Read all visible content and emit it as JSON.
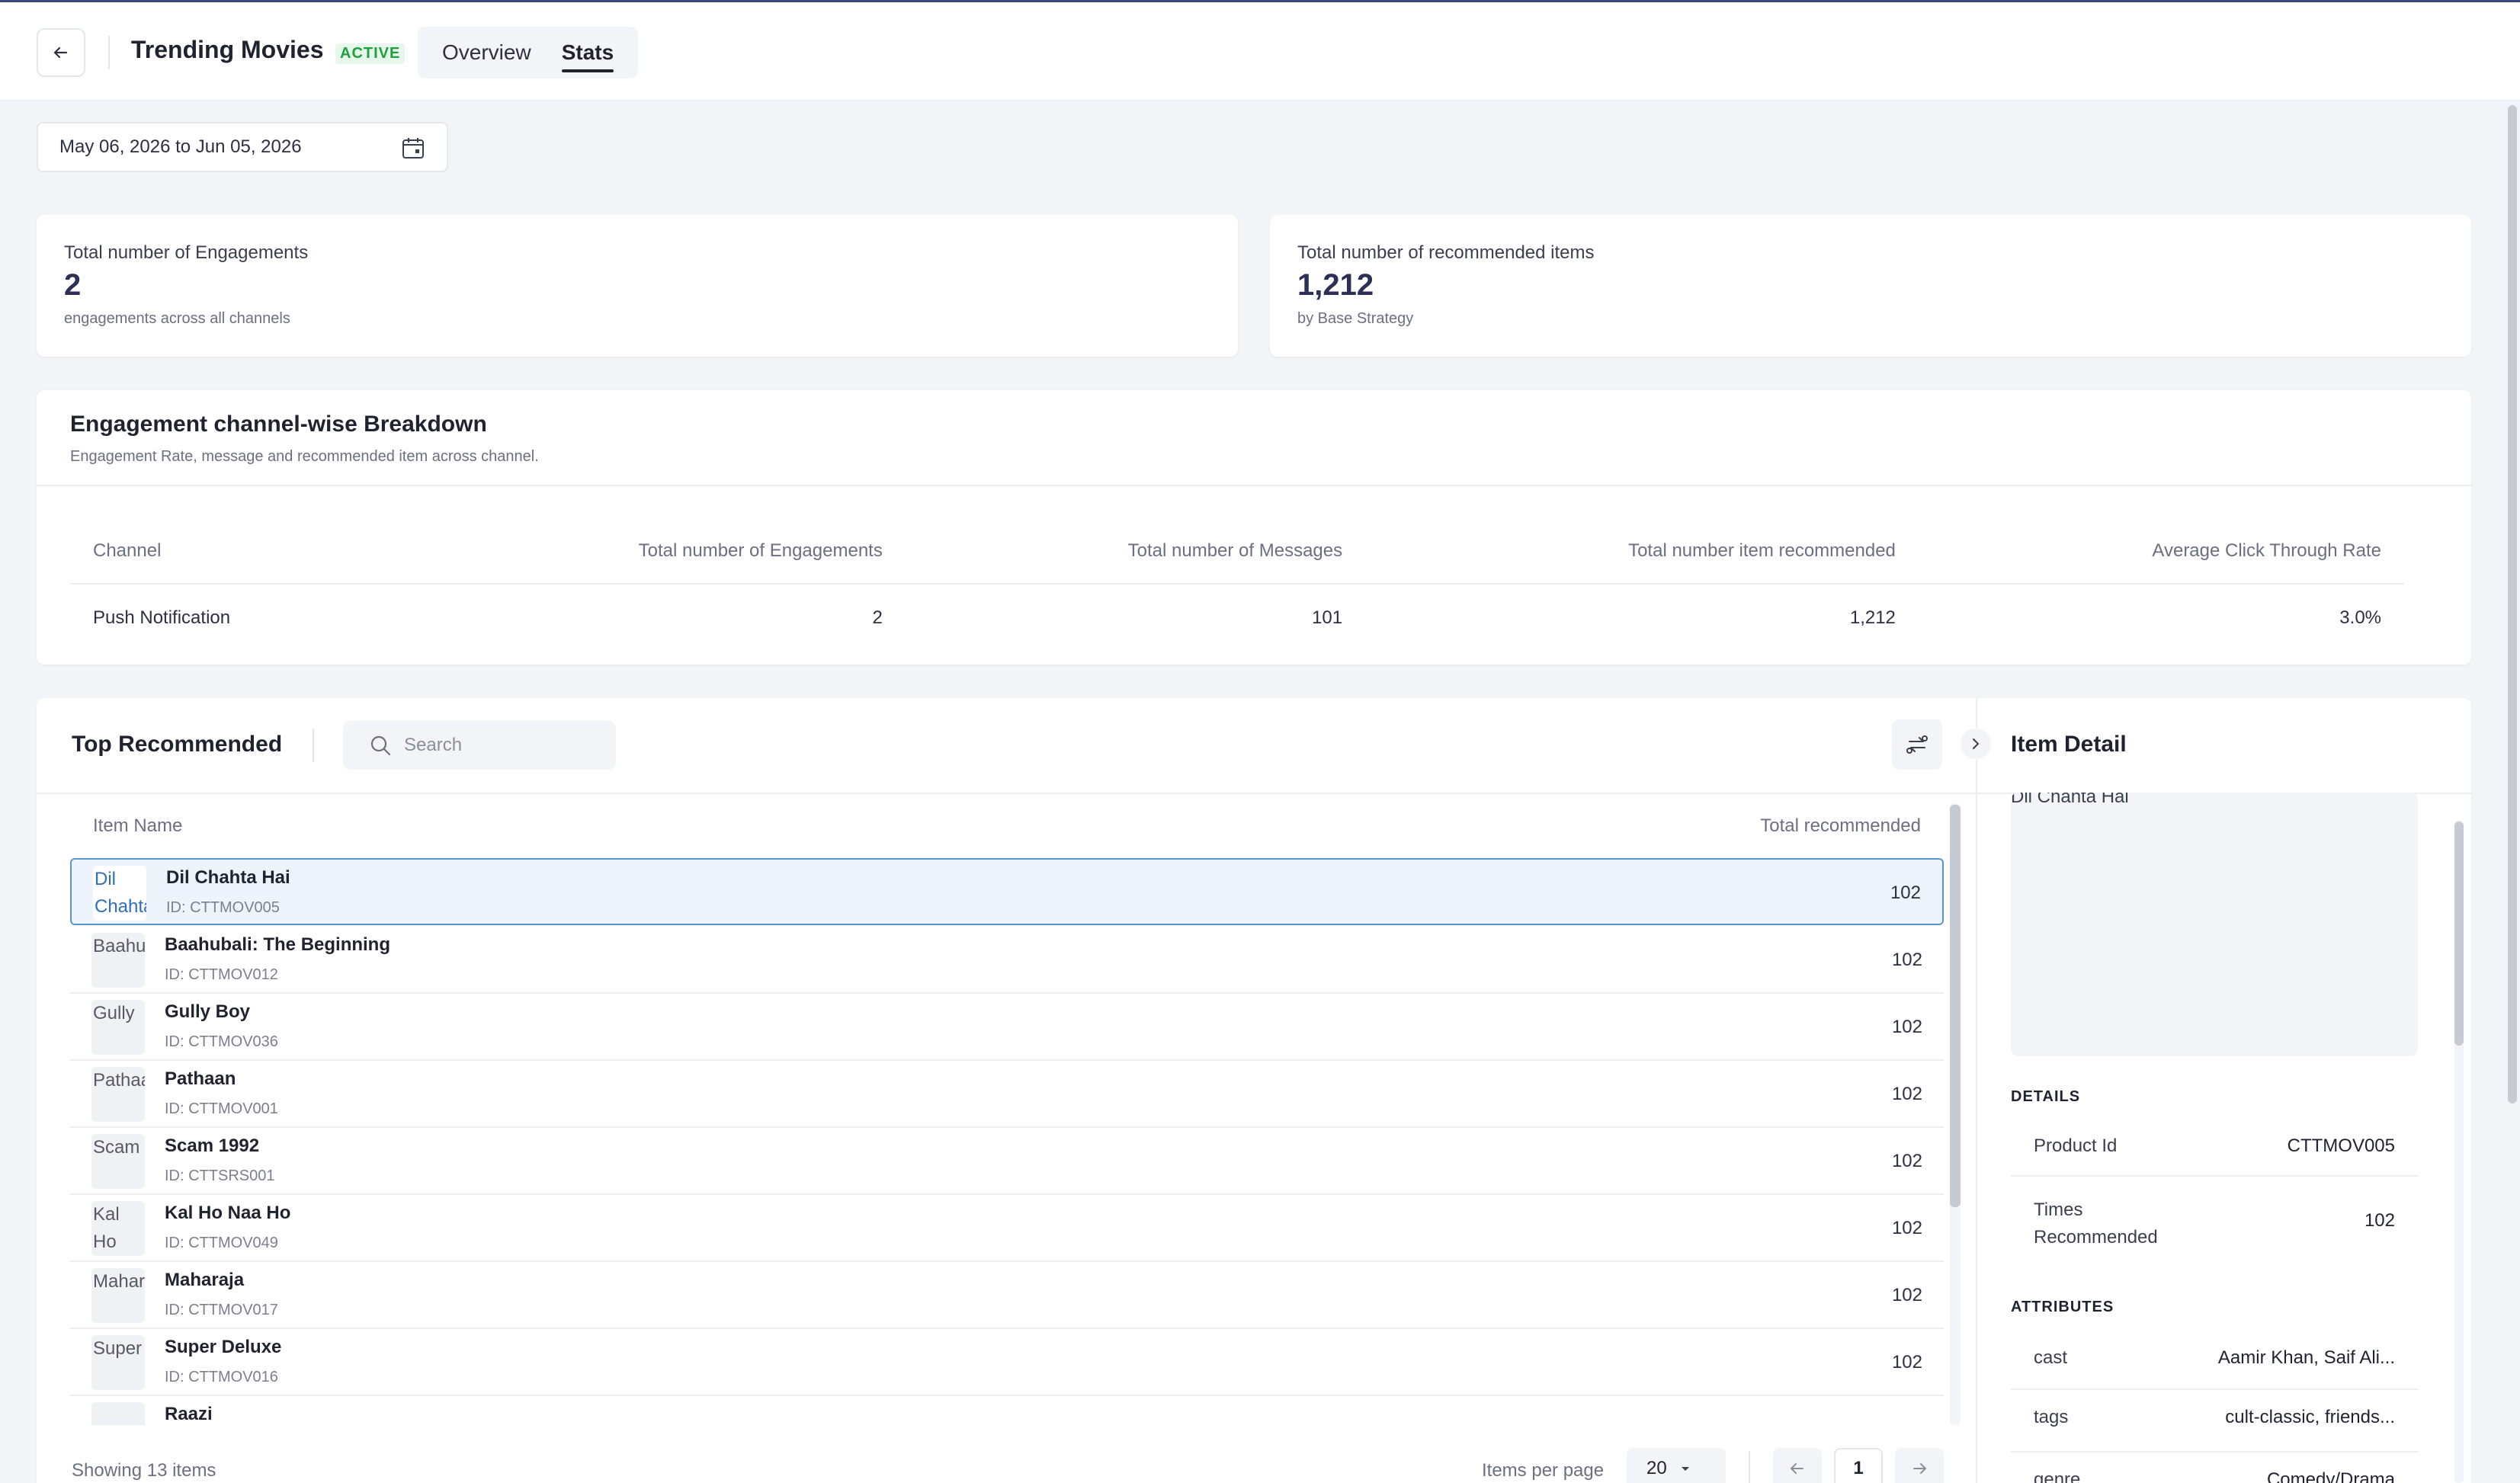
{
  "header": {
    "title": "Trending Movies",
    "status": "ACTIVE",
    "tabs": [
      {
        "label": "Overview",
        "active": false
      },
      {
        "label": "Stats",
        "active": true
      }
    ]
  },
  "date_range": "May 06, 2026 to Jun 05, 2026",
  "stats": {
    "engagements": {
      "label": "Total number of Engagements",
      "value": "2",
      "sub": "engagements across all channels"
    },
    "recommended": {
      "label": "Total number of recommended items",
      "value": "1,212",
      "sub": "by Base Strategy"
    }
  },
  "breakdown": {
    "title": "Engagement channel-wise Breakdown",
    "subtitle": "Engagement Rate, message and recommended item across channel.",
    "columns": [
      "Channel",
      "Total number of Engagements",
      "Total number of Messages",
      "Total number item recommended",
      "Average Click Through Rate"
    ],
    "rows": [
      {
        "channel": "Push Notification",
        "engagements": "2",
        "messages": "101",
        "items": "1,212",
        "ctr": "3.0%"
      }
    ]
  },
  "top_recommended": {
    "title": "Top Recommended",
    "search_placeholder": "Search",
    "col_item": "Item Name",
    "col_total": "Total recommended",
    "items": [
      {
        "alt": "Dil Chahta",
        "name": "Dil Chahta Hai",
        "id": "ID: CTTMOV005",
        "count": "102"
      },
      {
        "alt": "Baahu",
        "name": "Baahubali: The Beginning",
        "id": "ID: CTTMOV012",
        "count": "102"
      },
      {
        "alt": "Gully",
        "name": "Gully Boy",
        "id": "ID: CTTMOV036",
        "count": "102"
      },
      {
        "alt": "Pathaa",
        "name": "Pathaan",
        "id": "ID: CTTMOV001",
        "count": "102"
      },
      {
        "alt": "Scam",
        "name": "Scam 1992",
        "id": "ID: CTTSRS001",
        "count": "102"
      },
      {
        "alt": "Kal Ho",
        "name": "Kal Ho Naa Ho",
        "id": "ID: CTTMOV049",
        "count": "102"
      },
      {
        "alt": "Mahar",
        "name": "Maharaja",
        "id": "ID: CTTMOV017",
        "count": "102"
      },
      {
        "alt": "Super",
        "name": "Super Deluxe",
        "id": "ID: CTTMOV016",
        "count": "102"
      },
      {
        "alt": "",
        "name": "Raazi",
        "id": "",
        "count": ""
      }
    ],
    "footer": {
      "showing": "Showing 13 items",
      "per_page_label": "Items per page",
      "per_page_value": "20",
      "page": "1"
    }
  },
  "item_detail": {
    "title": "Item Detail",
    "image_alt": "Dil Chahta Hai",
    "details_label": "DETAILS",
    "product_id_label": "Product Id",
    "product_id": "CTTMOV005",
    "times_label": "Times Recommended",
    "times": "102",
    "attributes_label": "ATTRIBUTES",
    "attributes": [
      {
        "key": "cast",
        "value": "Aamir Khan, Saif Ali..."
      },
      {
        "key": "tags",
        "value": "cult-classic, friends..."
      },
      {
        "key": "genre",
        "value": "Comedy/Drama"
      }
    ]
  }
}
